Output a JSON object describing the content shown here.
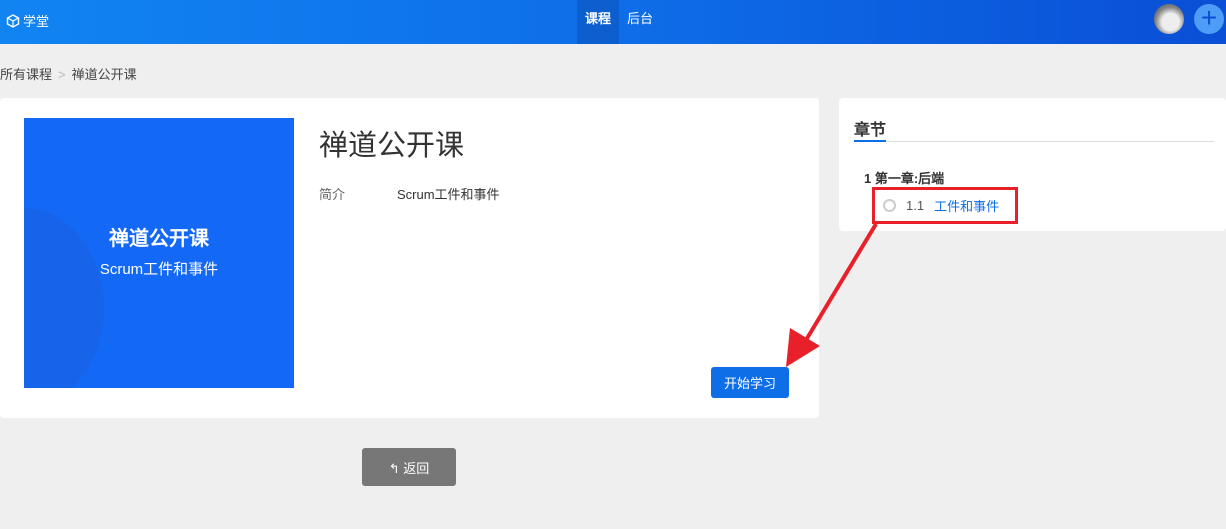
{
  "nav": {
    "brand": "学堂",
    "items": [
      {
        "label": "课程",
        "active": true
      },
      {
        "label": "后台",
        "active": false
      }
    ]
  },
  "breadcrumb": {
    "root": "所有课程",
    "sep": ">",
    "current": "禅道公开课"
  },
  "course": {
    "cover_title": "禅道公开课",
    "cover_subtitle": "Scrum工件和事件",
    "title": "禅道公开课",
    "intro_label": "简介",
    "intro_value": "Scrum工件和事件",
    "start_label": "开始学习"
  },
  "back_label": "返回",
  "chapters": {
    "heading": "章节",
    "items": [
      {
        "label": "1 第一章:后端",
        "lessons": [
          {
            "num": "1.1",
            "name": "工件和事件"
          }
        ]
      }
    ]
  },
  "colors": {
    "accent": "#0e6ee8",
    "annotation": "#e8202a"
  }
}
